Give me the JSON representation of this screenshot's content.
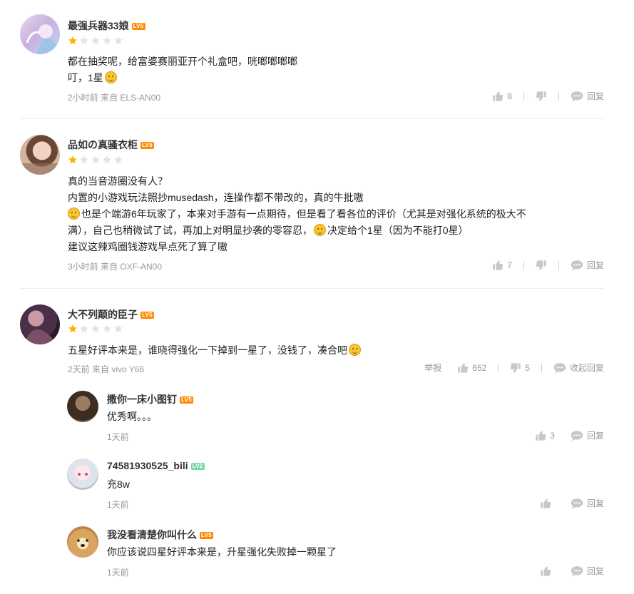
{
  "comments": [
    {
      "username": "最强兵器33娘",
      "level": "LV5",
      "rating": 1,
      "lines": [
        "都在抽奖呢，给富婆赛丽亚开个礼盒吧，咣啷啷啷啷",
        "叮，1星"
      ],
      "time": "2小时前 来自 ELS-AN00",
      "likes": "8",
      "reply": "回复"
    },
    {
      "username": "品如の真骚衣柜",
      "level": "LV5",
      "rating": 1,
      "lines": [
        "真的当音游圈没有人？",
        "内置的小游戏玩法照抄musedash，连操作都不带改的，真的牛批嗷",
        "也是个端游6年玩家了，本来对手游有一点期待，但是看了看各位的评价（尤其是对强化系统的极大不",
        "满），自己也稍微试了试，再加上对明显抄袭的零容忍，",
        "决定给个1星（因为不能打0星）",
        "建议这辣鸡圈钱游戏早点死了算了嗷"
      ],
      "time": "3小时前 来自 OXF-AN00",
      "likes": "7",
      "reply": "回复"
    },
    {
      "username": "大不列颠的臣子",
      "level": "LV5",
      "rating": 1,
      "lines": [
        "五星好评本来是，谁晓得强化一下掉到一星了，没钱了，凑合吧"
      ],
      "time": "2天前 来自 vivo Y66",
      "report": "举报",
      "likes": "652",
      "dislikes": "5",
      "collapse_reply": "收起回复"
    }
  ],
  "replies": [
    {
      "username": "撒你一床小图钉",
      "level": "LV5",
      "text": "优秀啊。。。",
      "time": "1天前",
      "likes": "3",
      "reply": "回复"
    },
    {
      "username": "74581930525_bili",
      "level": "LV2",
      "text": "充8w",
      "time": "1天前",
      "likes": "",
      "reply": "回复"
    },
    {
      "username": "我没看清楚你叫什么",
      "level": "LV5",
      "text": "你应该说四星好评本来是，升星强化失败掉一颗星了",
      "time": "1天前",
      "likes": "",
      "reply": "回复"
    }
  ],
  "colors": {
    "star_on": "#ffb300",
    "star_off": "#e3e3e3",
    "level_badge": "#ff8a00",
    "level_badge_low": "#7ad6a6",
    "meta_text": "#999999"
  }
}
